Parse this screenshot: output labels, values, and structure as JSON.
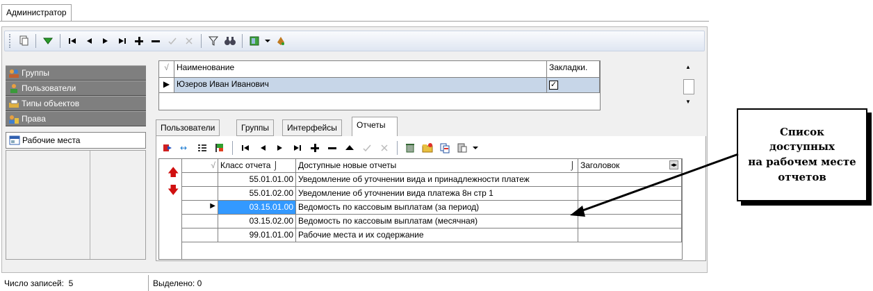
{
  "window_tab": "Администратор",
  "toolbar_icons": [
    "copy-icon",
    "filter-down-icon",
    "first-icon",
    "prev-icon",
    "next-icon",
    "last-icon",
    "add-icon",
    "remove-icon",
    "confirm-icon",
    "cancel-icon",
    "filter-icon",
    "binoculars-icon",
    "book-icon",
    "dropdown-icon",
    "paint-icon"
  ],
  "nav": {
    "items": [
      {
        "label": "Группы",
        "icon": "group-icon"
      },
      {
        "label": "Пользователи",
        "icon": "user-icon"
      },
      {
        "label": "Типы объектов",
        "icon": "object-types-icon"
      },
      {
        "label": "Права",
        "icon": "rights-icon"
      },
      {
        "label": "Рабочие места",
        "icon": "workplace-icon",
        "selected": true
      }
    ]
  },
  "upper_grid": {
    "columns": [
      "Наименование",
      "Закладки."
    ],
    "rows": [
      {
        "name": "Юзеров Иван Иванович",
        "bookmark_checked": true
      }
    ]
  },
  "subtabs": [
    "Пользователи",
    "Группы",
    "Интерфейсы",
    "Отчеты"
  ],
  "active_subtab": "Отчеты",
  "lower_grid": {
    "columns": [
      "Класс отчета",
      "Доступные новые отчеты",
      "Заголовок"
    ],
    "rows": [
      {
        "code": "55.01.01.00",
        "name": "Уведомление об уточнении вида и принадлежности платеж"
      },
      {
        "code": "55.01.02.00",
        "name": "Уведомление об уточнении вида платежа 8н стр 1"
      },
      {
        "code": "03.15.01.00",
        "name": "Ведомость по кассовым выплатам (за период)",
        "selected": true
      },
      {
        "code": "03.15.02.00",
        "name": "Ведомость по кассовым выплатам (месячная)"
      },
      {
        "code": "99.01.01.00",
        "name": "Рабочие места и их содержание"
      }
    ]
  },
  "status": {
    "records_label": "Число записей:",
    "records_value": "5",
    "selected_label": "Выделено:",
    "selected_value": "0"
  },
  "callout": {
    "line1": "Список",
    "line2": "доступных",
    "line3": "на рабочем месте",
    "line4": "отчетов"
  },
  "colors": {
    "selection": "#3399ff",
    "nav_bg": "#7f7f7f",
    "toolbar": "#dfe6f2"
  }
}
